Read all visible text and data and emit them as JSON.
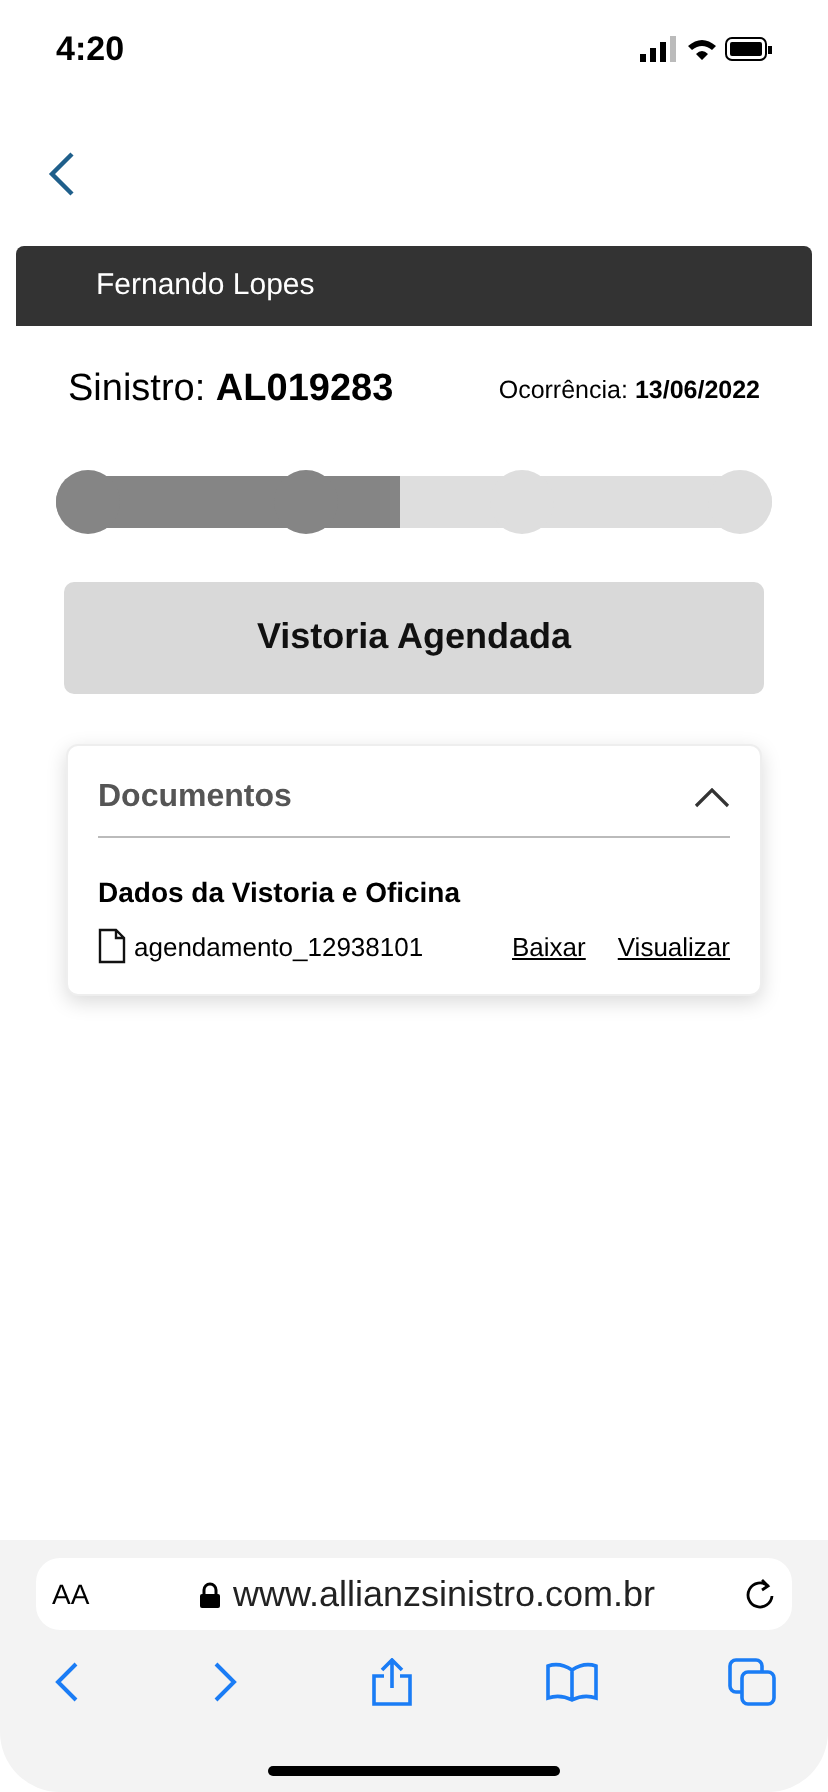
{
  "status_bar": {
    "time": "4:20"
  },
  "user_bar": {
    "name": "Fernando Lopes"
  },
  "claim": {
    "number": "Sinistro: **AL019283**",
    "date": "Ocorrência: **13/06/2022**"
  },
  "progress": {
    "level": 0.48,
    "steps": [
      {
        "done": true
      },
      {
        "done": true
      },
      {
        "done": false
      },
      {
        "done": false
      }
    ]
  },
  "status_button": {
    "label": "Vistoria Agendada"
  },
  "documents": {
    "title": "Documentos",
    "expanded": true,
    "section": "Dados da Vistoria e Oficina",
    "files": [
      {
        "name": "agendamento_12938101",
        "download": "Baixar",
        "view": "Visualizar"
      }
    ]
  },
  "browser": {
    "text_size": "AA",
    "url": "www.allianzsinistro.com.br"
  }
}
